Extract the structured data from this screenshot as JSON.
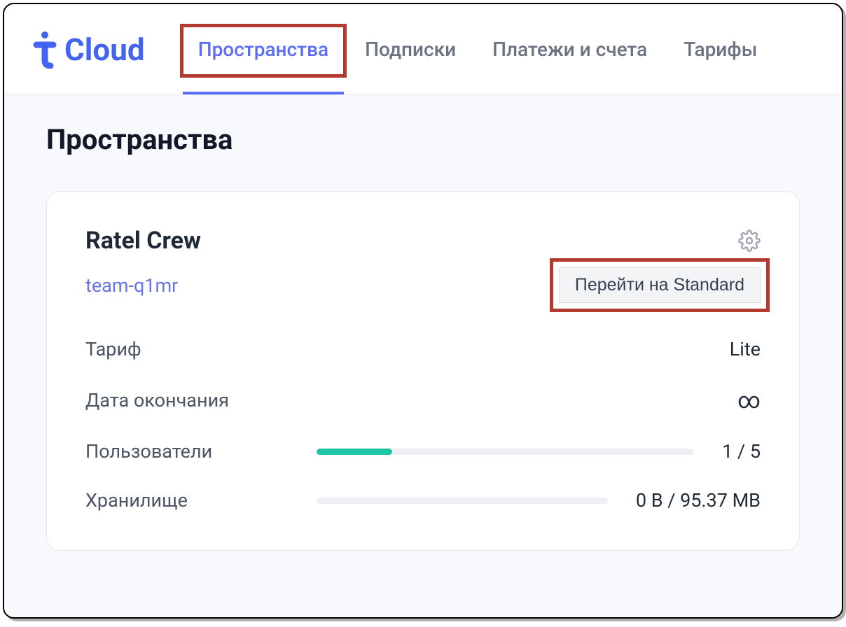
{
  "logo": {
    "text": "Cloud"
  },
  "nav": {
    "items": [
      {
        "label": "Пространства",
        "active": true
      },
      {
        "label": "Подписки",
        "active": false
      },
      {
        "label": "Платежи и счета",
        "active": false
      },
      {
        "label": "Тарифы",
        "active": false
      }
    ]
  },
  "page": {
    "title": "Пространства"
  },
  "space": {
    "name": "Ratel Crew",
    "team_id": "team-q1mr",
    "upgrade_button": "Перейти на Standard",
    "rows": {
      "tariff": {
        "label": "Тариф",
        "value": "Lite"
      },
      "end_date": {
        "label": "Дата окончания",
        "value": "∞"
      },
      "users": {
        "label": "Пользователи",
        "value": "1 / 5",
        "progress_pct": 20
      },
      "storage": {
        "label": "Хранилище",
        "value": "0 B / 95.37 MB",
        "progress_pct": 0
      }
    }
  }
}
